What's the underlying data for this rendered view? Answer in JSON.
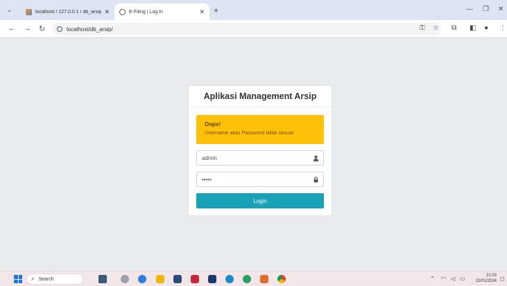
{
  "browser": {
    "tabs": [
      {
        "title": "localhost / 127.0.0.1 / db_arsip |",
        "icon": "phpmyadmin-icon"
      },
      {
        "title": "E-Filing | Log In",
        "icon": "globe-icon"
      }
    ],
    "address": "localhost/db_arsip/"
  },
  "login": {
    "title": "Aplikasi Management Arsip",
    "alert_title": "Oops!",
    "alert_message": "Username atau Password tidak sesuai",
    "username_value": "admin",
    "password_value": "•••••",
    "login_label": "Login",
    "accent": "#17a2b8",
    "alert_color": "#ffc107"
  },
  "taskbar": {
    "search_label": "Search",
    "time": "21:03",
    "date": "22/01/2024"
  }
}
